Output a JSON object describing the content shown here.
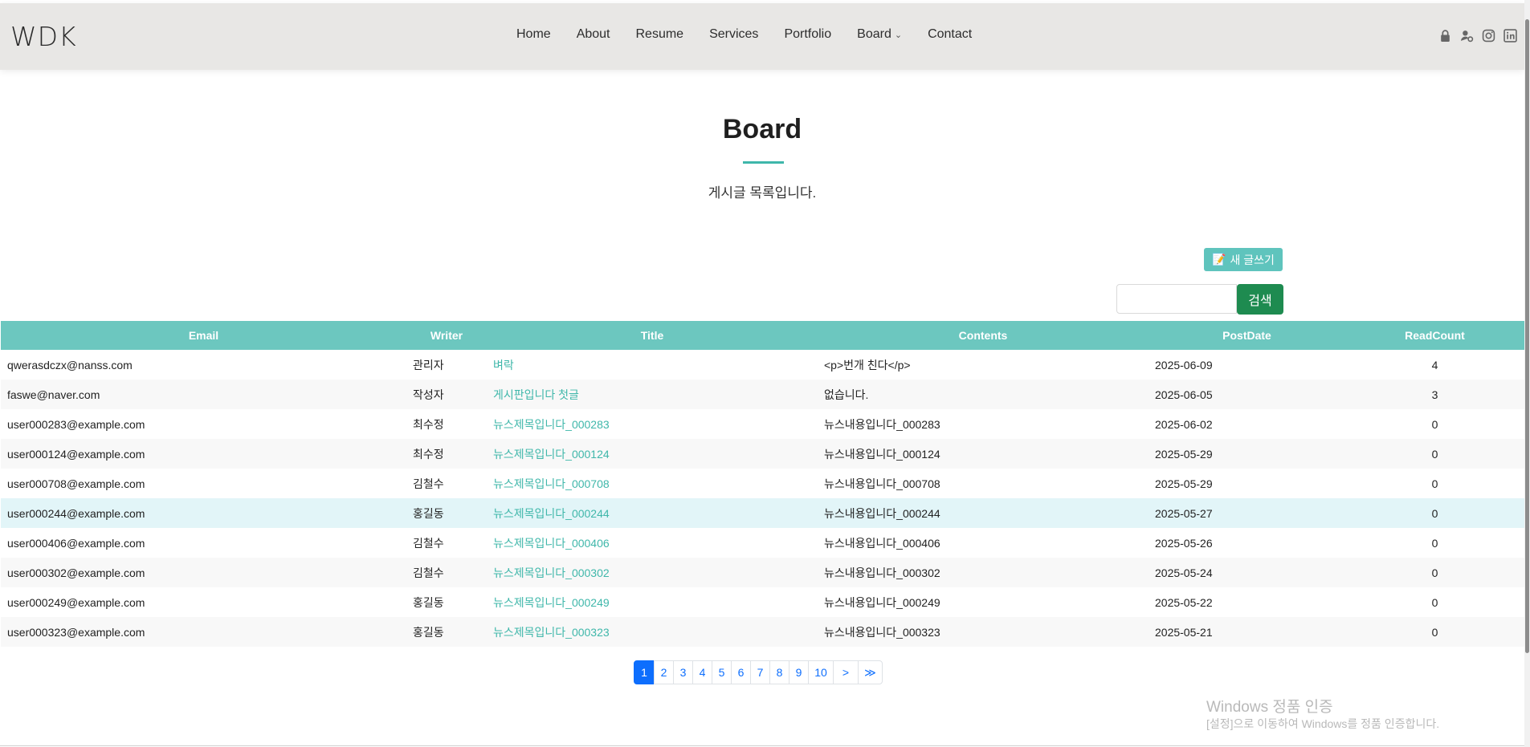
{
  "header": {
    "logo": "WDK",
    "nav": [
      {
        "label": "Home"
      },
      {
        "label": "About"
      },
      {
        "label": "Resume"
      },
      {
        "label": "Services"
      },
      {
        "label": "Portfolio"
      },
      {
        "label": "Board"
      },
      {
        "label": "Contact"
      }
    ],
    "social_icons": [
      "lock-icon",
      "user-settings-icon",
      "instagram-icon",
      "linkedin-icon"
    ]
  },
  "section": {
    "title": "Board",
    "subtitle": "게시글 목록입니다."
  },
  "actions": {
    "new_post_label": "새 글쓰기",
    "search_placeholder": "",
    "search_button": "검색"
  },
  "table": {
    "headers": [
      "Email",
      "Writer",
      "Title",
      "Contents",
      "PostDate",
      "ReadCount"
    ],
    "rows": [
      {
        "email": "qwerasdczx@nanss.com",
        "writer": "관리자",
        "title": "벼락",
        "contents": "<p>번개 친다</p>",
        "date": "2025-06-09",
        "reads": "4"
      },
      {
        "email": "faswe@naver.com",
        "writer": "작성자",
        "title": "게시판입니다 첫글",
        "contents": "없습니다.",
        "date": "2025-06-05",
        "reads": "3"
      },
      {
        "email": "user000283@example.com",
        "writer": "최수정",
        "title": "뉴스제목입니다_000283",
        "contents": "뉴스내용입니다_000283",
        "date": "2025-06-02",
        "reads": "0"
      },
      {
        "email": "user000124@example.com",
        "writer": "최수정",
        "title": "뉴스제목입니다_000124",
        "contents": "뉴스내용입니다_000124",
        "date": "2025-05-29",
        "reads": "0"
      },
      {
        "email": "user000708@example.com",
        "writer": "김철수",
        "title": "뉴스제목입니다_000708",
        "contents": "뉴스내용입니다_000708",
        "date": "2025-05-29",
        "reads": "0"
      },
      {
        "email": "user000244@example.com",
        "writer": "홍길동",
        "title": "뉴스제목입니다_000244",
        "contents": "뉴스내용입니다_000244",
        "date": "2025-05-27",
        "reads": "0"
      },
      {
        "email": "user000406@example.com",
        "writer": "김철수",
        "title": "뉴스제목입니다_000406",
        "contents": "뉴스내용입니다_000406",
        "date": "2025-05-26",
        "reads": "0"
      },
      {
        "email": "user000302@example.com",
        "writer": "김철수",
        "title": "뉴스제목입니다_000302",
        "contents": "뉴스내용입니다_000302",
        "date": "2025-05-24",
        "reads": "0"
      },
      {
        "email": "user000249@example.com",
        "writer": "홍길동",
        "title": "뉴스제목입니다_000249",
        "contents": "뉴스내용입니다_000249",
        "date": "2025-05-22",
        "reads": "0"
      },
      {
        "email": "user000323@example.com",
        "writer": "홍길동",
        "title": "뉴스제목입니다_000323",
        "contents": "뉴스내용입니다_000323",
        "date": "2025-05-21",
        "reads": "0"
      }
    ],
    "hover_row": 5
  },
  "pagination": {
    "pages": [
      "1",
      "2",
      "3",
      "4",
      "5",
      "6",
      "7",
      "8",
      "9",
      "10"
    ],
    "current": "1",
    "next": ">",
    "last": "≫"
  },
  "watermark": {
    "title": "Windows 정품 인증",
    "subtitle": "[설정]으로 이동하여 Windows를 정품 인증합니다."
  },
  "colors": {
    "accent": "#3fb7aa",
    "table_header": "#6cc7bf",
    "search_button": "#1e8b50",
    "pagination_active": "#0d6efd"
  }
}
